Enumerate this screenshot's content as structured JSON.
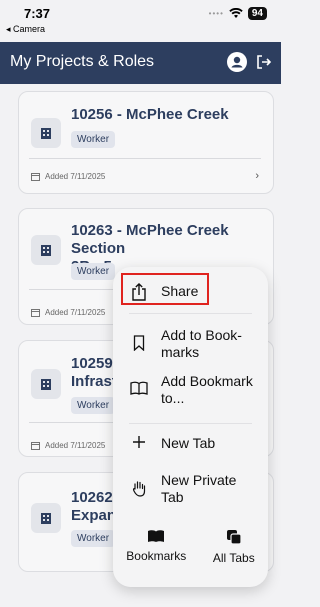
{
  "status_bar": {
    "time": "7:37",
    "back_app": "◂ Camera",
    "battery": "94"
  },
  "header": {
    "title": "My Projects & Roles"
  },
  "projects": [
    {
      "title": "10256 - McPhee Creek",
      "role": "Worker",
      "added": "Added 7/11/2025"
    },
    {
      "title": "10263 - McPhee Creek Section\n2B - 5",
      "role": "Worker",
      "added": "Added 7/11/2025"
    },
    {
      "title": "10259 -\nInfrast",
      "role": "Worker",
      "added": "Added 7/11/2025"
    },
    {
      "title": "10262\nExpans",
      "role": "Worker",
      "added": ""
    }
  ],
  "context_menu": {
    "items": [
      {
        "label": "Share",
        "icon": "share-icon"
      },
      {
        "label": "Add to Book-\nmarks",
        "icon": "bookmark-icon"
      },
      {
        "label": "Add Bookmark\nto...",
        "icon": "book-icon"
      },
      {
        "label": "New Tab",
        "icon": "plus-icon"
      },
      {
        "label": "New Private\nTab",
        "icon": "hand-icon"
      }
    ],
    "bottom": [
      {
        "label": "Bookmarks",
        "icon": "bookmarks-book-icon"
      },
      {
        "label": "All Tabs",
        "icon": "tabs-icon"
      }
    ],
    "highlight_color": "#e0231f"
  },
  "colors": {
    "header_bg": "#2d3e5f",
    "title_color": "#2d3e5f"
  }
}
